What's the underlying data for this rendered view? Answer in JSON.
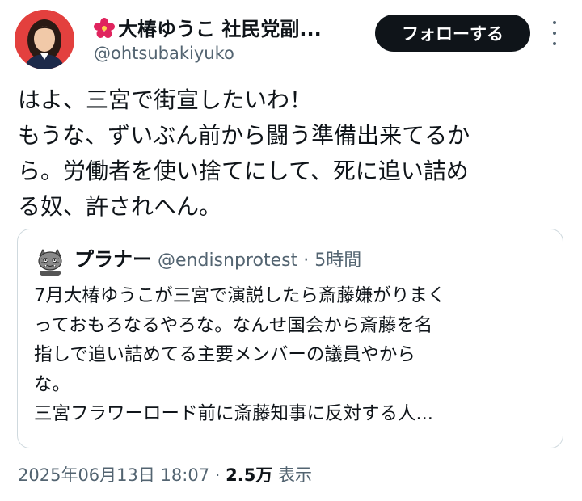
{
  "author": {
    "display_name": "大椿ゆうこ 社民党副...",
    "handle": "@ohtsubakiyuko",
    "name_icon": "hibiscus-icon",
    "avatar_bg": "#e3403e"
  },
  "follow_label": "フォローする",
  "tweet_lines": [
    "はよ、三宮で街宣したいわ！",
    "もうな、ずいぶん前から闘う準備出来てるか",
    "ら。労働者を使い捨てにして、死に追い詰め",
    "る奴、許されへん。"
  ],
  "quote": {
    "name": "プラナー",
    "handle": "@endisnprotest",
    "separator": "·",
    "time": "5時間",
    "lines": [
      "7月大椿ゆうこが三宮で演説したら斎藤嫌がりまく",
      "っておもろなるやろな。なんせ国会から斎藤を名",
      "指しで追い詰めてる主要メンバーの議員やから",
      "な。",
      "三宮フラワーロード前に斎藤知事に反対する人..."
    ]
  },
  "meta": {
    "date": "2025年06月13日 18:07",
    "separator": "·",
    "views_count": "2.5万",
    "views_label": "表示"
  },
  "colors": {
    "text": "#0f1419",
    "secondary": "#536471",
    "border": "#cfd9de",
    "button_bg": "#0f1419",
    "hibiscus": "#e0245e"
  }
}
